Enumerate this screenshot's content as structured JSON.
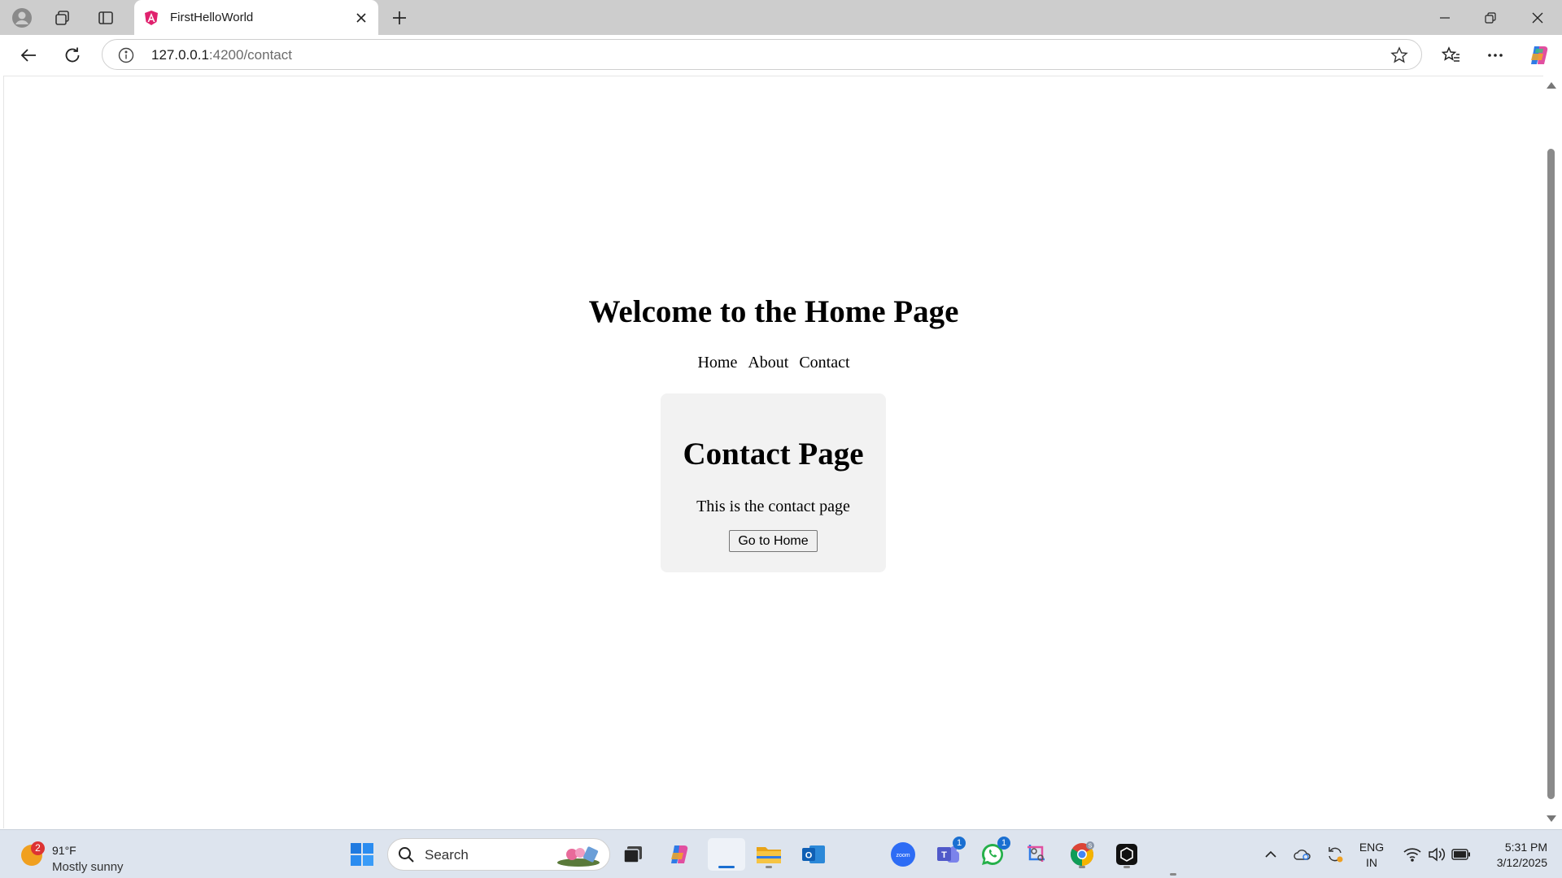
{
  "browser": {
    "tab_title": "FirstHelloWorld",
    "url_host": "127.0.0.1",
    "url_path": ":4200/contact"
  },
  "page": {
    "heading": "Welcome to the Home Page",
    "nav": [
      "Home",
      "About",
      "Contact"
    ],
    "card_title": "Contact Page",
    "card_text": "This is the contact page",
    "card_button": "Go to Home"
  },
  "taskbar": {
    "weather_temp": "91°F",
    "weather_desc": "Mostly sunny",
    "weather_badge": "2",
    "search_label": "Search",
    "teams_badge": "1",
    "whatsapp_badge": "1",
    "lang_line1": "ENG",
    "lang_line2": "IN",
    "time": "5:31 PM",
    "date": "3/12/2025"
  }
}
